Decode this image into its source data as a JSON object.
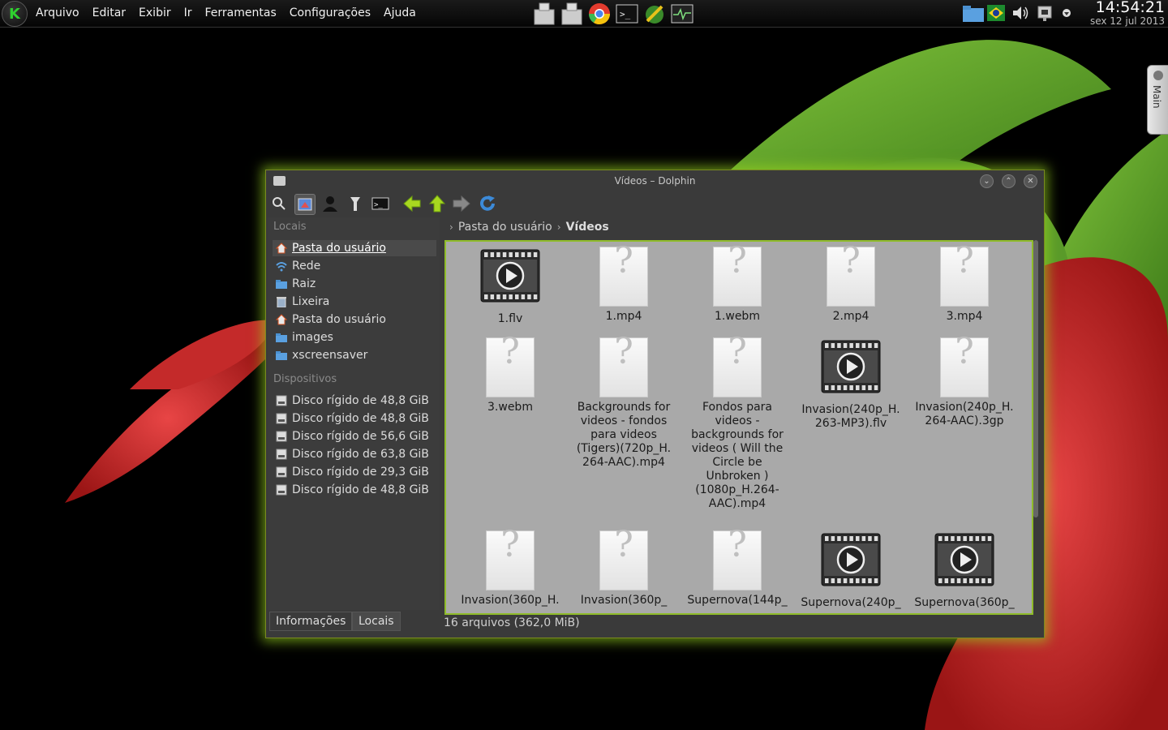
{
  "panel": {
    "menu": [
      "Arquivo",
      "Editar",
      "Exibir",
      "Ir",
      "Ferramentas",
      "Configurações",
      "Ajuda"
    ],
    "launchers": [
      "pager-1-icon",
      "pager-2-icon",
      "chrome-icon",
      "terminal-icon",
      "software-icon",
      "system-monitor-icon"
    ],
    "tray": [
      "folder-icon",
      "flag-icon",
      "volume-icon",
      "network-icon",
      "arrow-icon"
    ],
    "clock_time": "14:54:21",
    "clock_date": "sex 12 jul 2013",
    "k_letter": "K"
  },
  "side_tab": {
    "label": "Main"
  },
  "window": {
    "title": "Vídeos – Dolphin",
    "places_title": "Locais",
    "places": [
      {
        "label": "Pasta do usuário",
        "icon": "home-icon",
        "selected": true
      },
      {
        "label": "Rede",
        "icon": "network-icon"
      },
      {
        "label": "Raiz",
        "icon": "folder-icon"
      },
      {
        "label": "Lixeira",
        "icon": "trash-icon"
      },
      {
        "label": "Pasta do usuário",
        "icon": "home-icon"
      },
      {
        "label": "images",
        "icon": "folder-icon"
      },
      {
        "label": "xscreensaver",
        "icon": "folder-icon"
      }
    ],
    "devices_title": "Dispositivos",
    "devices": [
      "Disco rígido de 48,8 GiB",
      "Disco rígido de 48,8 GiB",
      "Disco rígido de 56,6 GiB",
      "Disco rígido de 63,8 GiB",
      "Disco rígido de 29,3 GiB",
      "Disco rígido de 48,8 GiB"
    ],
    "panel_tabs": [
      "Informações",
      "Locais"
    ],
    "breadcrumb": [
      "Pasta do usuário",
      "Vídeos"
    ],
    "files": [
      {
        "name": "1.flv",
        "icon": "video"
      },
      {
        "name": "1.mp4",
        "icon": "unknown"
      },
      {
        "name": "1.webm",
        "icon": "unknown"
      },
      {
        "name": "2.mp4",
        "icon": "unknown"
      },
      {
        "name": "3.mp4",
        "icon": "unknown"
      },
      {
        "name": "3.webm",
        "icon": "unknown"
      },
      {
        "name": "Backgrounds for videos - fondos para videos (Tigers)(720p_H.264-AAC).mp4",
        "icon": "unknown",
        "lines": [
          "Backgrounds for",
          "videos - fondos",
          "para videos",
          "(Tigers)(720p_H.",
          "264-AAC).mp4"
        ]
      },
      {
        "name": "Fondos para videos - backgrounds for videos ( Will the Circle be Unbroken ) (1080p_H.264-AAC).mp4",
        "icon": "unknown",
        "lines": [
          "Fondos para",
          "videos -",
          "backgrounds for",
          "videos ( Will the",
          "Circle be",
          "Unbroken )",
          "(1080p_H.264-",
          "AAC).mp4"
        ]
      },
      {
        "name": "Invasion(240p_H.263-MP3).flv",
        "icon": "video",
        "lines": [
          "Invasion(240p_H.",
          "263-MP3).flv"
        ]
      },
      {
        "name": "Invasion(240p_H.264-AAC).3gp",
        "icon": "unknown",
        "lines": [
          "Invasion(240p_H.",
          "264-AAC).3gp"
        ]
      },
      {
        "name": "Invasion(360p_H.",
        "icon": "unknown"
      },
      {
        "name": "Invasion(360p_",
        "icon": "unknown"
      },
      {
        "name": "Supernova(144p_",
        "icon": "unknown"
      },
      {
        "name": "Supernova(240p_",
        "icon": "video"
      },
      {
        "name": "Supernova(360p_",
        "icon": "video"
      }
    ],
    "status": "16 arquivos (362,0 MiB)"
  },
  "colors": {
    "accent_glow": "#8fbc2a",
    "view_bg": "#a9a9a9"
  }
}
